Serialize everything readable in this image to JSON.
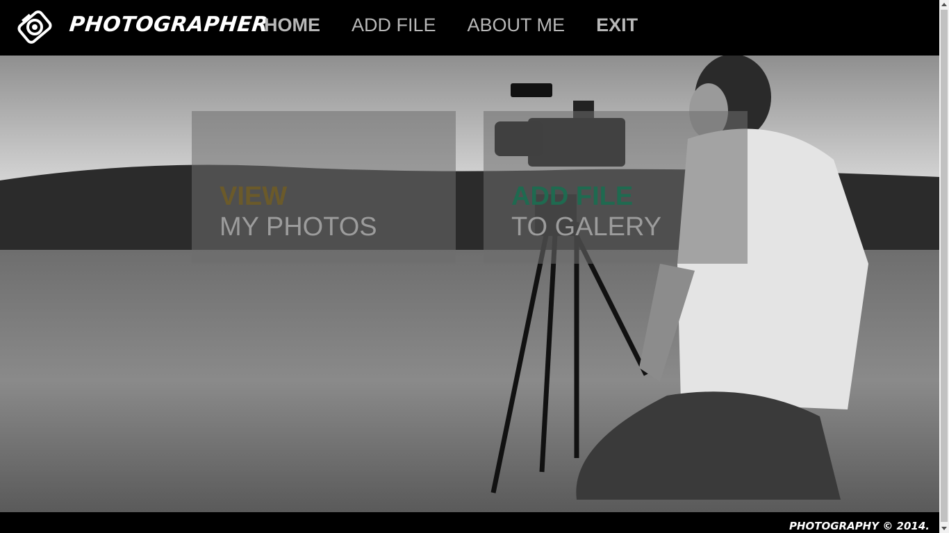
{
  "brand": {
    "name": "PHOTOGRAPHER",
    "icon": "camera-aperture-icon"
  },
  "nav": {
    "items": [
      {
        "label": "HOME",
        "bold": true
      },
      {
        "label": "ADD FILE",
        "bold": false
      },
      {
        "label": "ABOUT ME",
        "bold": false
      },
      {
        "label": "EXIT",
        "bold": true
      }
    ]
  },
  "tiles": [
    {
      "line1": "VIEW",
      "line2": "MY PHOTOS",
      "accent": "#6b5a2a"
    },
    {
      "line1": "ADD FILE",
      "line2": "TO GALERY",
      "accent": "#1f6a50"
    }
  ],
  "footer": {
    "text": "PHOTOGRAPHY © 2014."
  },
  "colors": {
    "topbar": "#000000",
    "nav_text": "#b8b8b8"
  }
}
